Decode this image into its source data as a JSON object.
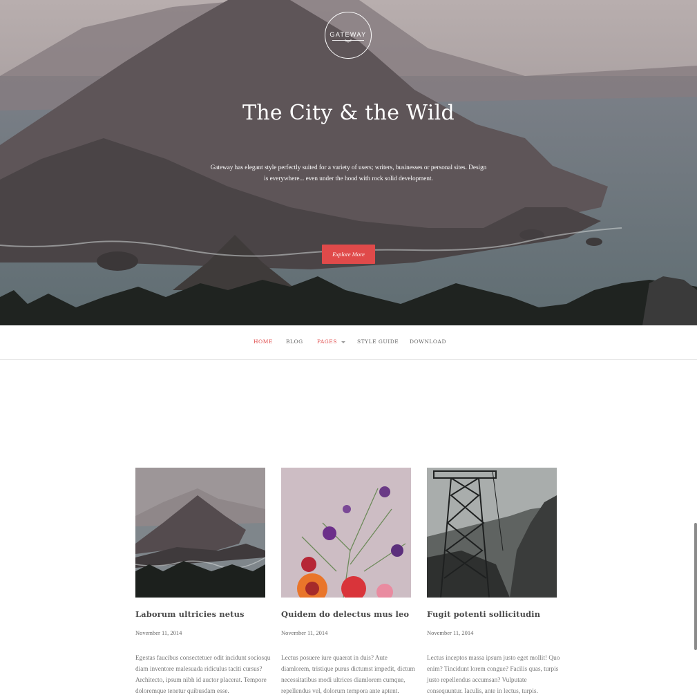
{
  "hero": {
    "logo_text": "GATEWAY",
    "logo_chevron": "︾",
    "title": "The City & the Wild",
    "description": "Gateway has elegant style perfectly suited for a variety of users; writers, businesses or personal sites. Design is everywhere... even under the hood with rock solid development.",
    "button_label": "Explore More"
  },
  "nav": {
    "items": [
      {
        "label": "Home",
        "active": true
      },
      {
        "label": "Blog",
        "active": false
      },
      {
        "label": "Pages",
        "active": true,
        "dropdown": true
      },
      {
        "label": "Style Guide",
        "active": false
      },
      {
        "label": "Download",
        "active": false
      }
    ]
  },
  "posts": [
    {
      "title": "Laborum ultricies netus",
      "date": "November 11, 2014",
      "excerpt": "Egestas faucibus consectetuer odit incidunt sociosqu diam inventore malesuada ridiculus taciti cursus? Architecto, ipsum nibh id auctor placerat. Tempore doloremque tenetur quibusdam esse."
    },
    {
      "title": "Quidem do delectus mus leo",
      "date": "November 11, 2014",
      "excerpt": "Lectus posuere iure quaerat in duis? Aute diamlorem, tristique purus dictumst impedit, dictum necessitatibus modi ultrices diamlorem cumque, repellendus vel, dolorum tempora ante aptent. Explicabo."
    },
    {
      "title": "Fugit potenti sollicitudin",
      "date": "November 11, 2014",
      "excerpt": "Lectus inceptos massa ipsum justo eget mollit! Quo enim? Tincidunt lorem congue? Facilis quas, turpis justo repellendus accumsan? Vulputate consequuntur. Iaculis, ante in lectus, turpis."
    }
  ],
  "colors": {
    "accent": "#e04a4a",
    "nav_text": "#666666",
    "title_text": "#4a4a4a"
  }
}
